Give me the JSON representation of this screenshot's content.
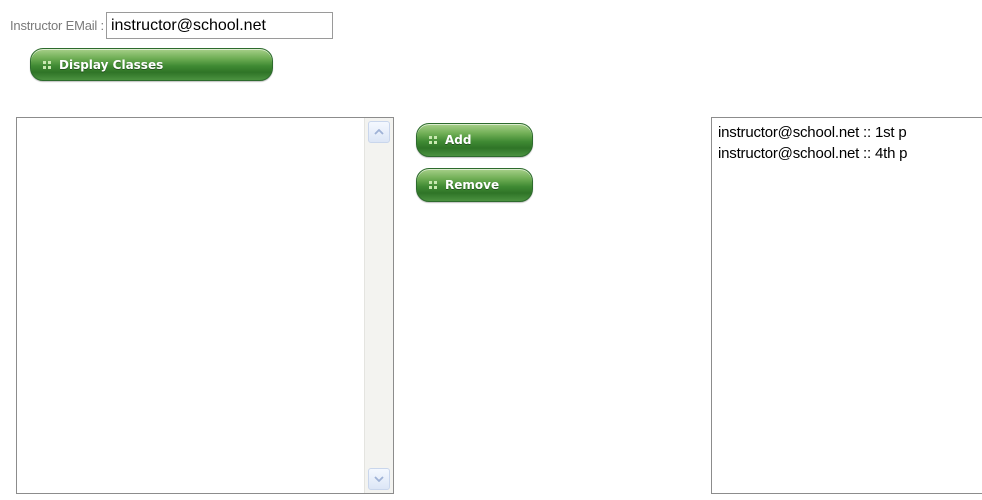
{
  "form": {
    "email_label": "Instructor EMail :",
    "email_value": "instructor@school.net"
  },
  "buttons": {
    "display_classes": "Display Classes",
    "add": "Add",
    "remove": "Remove"
  },
  "available_classes": {
    "items": []
  },
  "assigned_classes": {
    "items": [
      "instructor@school.net :: 1st p",
      "instructor@school.net :: 4th p"
    ]
  },
  "icons": {
    "button_grip": "grip-icon",
    "scroll_up": "arrow-up-icon",
    "scroll_down": "arrow-down-icon"
  },
  "colors": {
    "button_green": "#3f8a33",
    "button_border": "#2d6b2d",
    "label_gray": "#7a7a7a",
    "scroll_arrow": "#9fb2d6"
  }
}
